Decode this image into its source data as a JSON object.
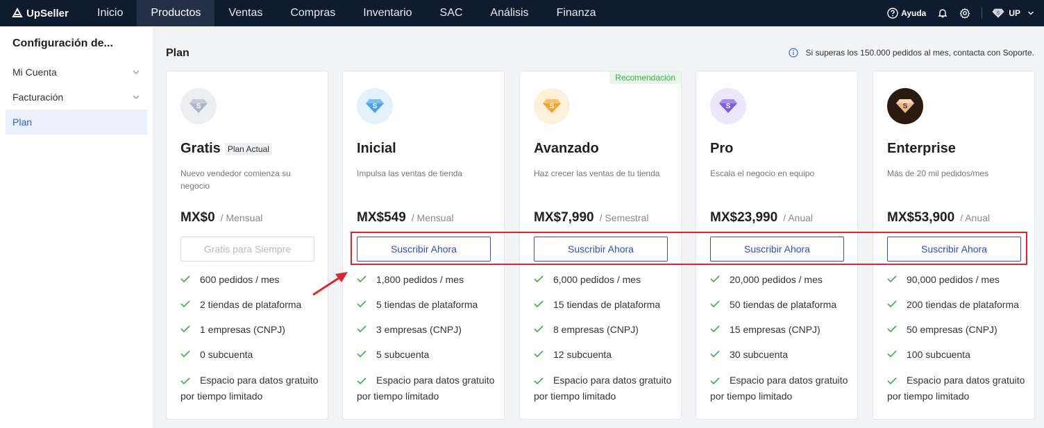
{
  "brand": {
    "name": "UpSeller"
  },
  "nav": [
    {
      "label": "Inicio"
    },
    {
      "label": "Productos",
      "active": true
    },
    {
      "label": "Ventas"
    },
    {
      "label": "Compras"
    },
    {
      "label": "Inventario"
    },
    {
      "label": "SAC"
    },
    {
      "label": "Análisis"
    },
    {
      "label": "Finanza"
    }
  ],
  "topright": {
    "help": "Ayuda",
    "user": "UP"
  },
  "sidebar": {
    "title": "Configuración de...",
    "items": [
      {
        "label": "Mi Cuenta",
        "expandable": true
      },
      {
        "label": "Facturación",
        "expandable": true
      },
      {
        "label": "Plan",
        "active": true
      }
    ]
  },
  "main": {
    "title": "Plan",
    "notice": "Si superas los 150.000 pedidos al mes, contacta con Soporte."
  },
  "plans": [
    {
      "name": "Gratis",
      "badge": "Plan Actual",
      "desc": "Nuevo vendedor comienza su negocio",
      "price": "MX$0",
      "period": "/ Mensual",
      "button": "Gratis para Siempre",
      "button_disabled": true,
      "icon": "diamond-gray-icon",
      "features": [
        "600 pedidos / mes",
        "2 tiendas de plataforma",
        "1 empresas (CNPJ)",
        "0 subcuenta",
        "Espacio para datos gratuito por tiempo limitado"
      ]
    },
    {
      "name": "Inicial",
      "desc": "Impulsa las ventas de tienda",
      "price": "MX$549",
      "period": "/ Mensual",
      "button": "Suscribir Ahora",
      "icon": "diamond-blue-icon",
      "features": [
        "1,800 pedidos / mes",
        "5 tiendas de plataforma",
        "3 empresas (CNPJ)",
        "5 subcuenta",
        "Espacio para datos gratuito por tiempo limitado"
      ]
    },
    {
      "name": "Avanzado",
      "desc": "Haz crecer las ventas de tu tienda",
      "price": "MX$7,990",
      "period": "/ Semestral",
      "button": "Suscribir Ahora",
      "recommend": "Recomendación",
      "icon": "diamond-orange-icon",
      "features": [
        "6,000 pedidos / mes",
        "15 tiendas de plataforma",
        "8 empresas (CNPJ)",
        "12 subcuenta",
        "Espacio para datos gratuito por tiempo limitado"
      ]
    },
    {
      "name": "Pro",
      "desc": "Escala el negocio en equipo",
      "price": "MX$23,990",
      "period": "/ Anual",
      "button": "Suscribir Ahora",
      "icon": "diamond-purple-icon",
      "features": [
        "20,000 pedidos / mes",
        "50 tiendas de plataforma",
        "15 empresas (CNPJ)",
        "30 subcuenta",
        "Espacio para datos gratuito por tiempo limitado"
      ]
    },
    {
      "name": "Enterprise",
      "desc": "Más de 20 mil pedidos/mes",
      "price": "MX$53,900",
      "period": "/ Anual",
      "button": "Suscribir Ahora",
      "icon": "diamond-gold-icon",
      "features": [
        "90,000 pedidos / mes",
        "200 tiendas de plataforma",
        "50 empresas (CNPJ)",
        "100 subcuenta",
        "Espacio para datos gratuito por tiempo limitado"
      ]
    }
  ],
  "colors": {
    "topbar": "#0f1b2e",
    "accent": "#2f4bd0",
    "check": "#3eab4a",
    "annotation": "#e0242b"
  }
}
